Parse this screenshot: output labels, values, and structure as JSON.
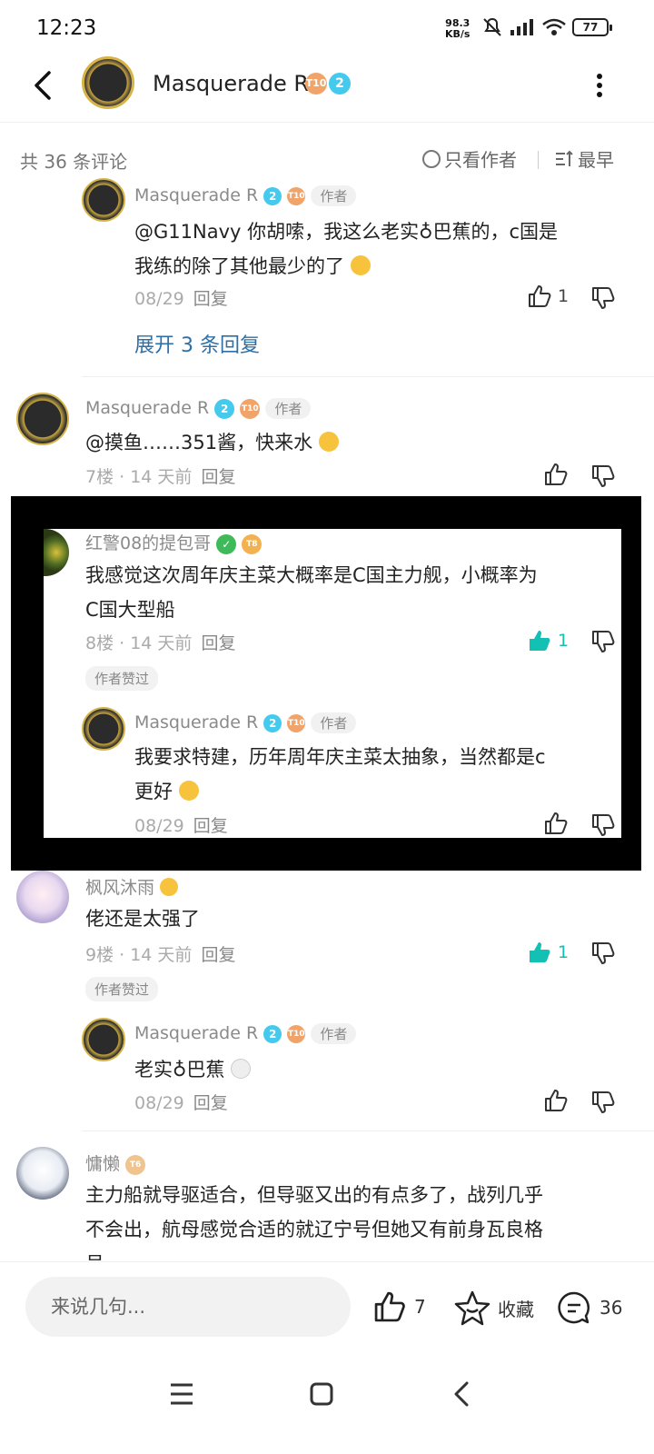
{
  "status": {
    "time": "12:23",
    "net_speed": "98.3",
    "net_unit": "KB/s",
    "battery": "77"
  },
  "header": {
    "name": "Masquerade R",
    "badge_level": "2",
    "badge_t": "T10"
  },
  "filter": {
    "count_label": "共 36 条评论",
    "only_author": "只看作者",
    "sort": "最早"
  },
  "comments": {
    "c0": {
      "name": "Masquerade R",
      "tag": "作者",
      "text_line1": "@G11Navy  你胡嗦，我这么老实♁巴蕉的，c国是",
      "text_line2": "我练的除了其他最少的了",
      "date": "08/29",
      "reply": "回复",
      "likes": "1",
      "expand": "展开 3 条回复"
    },
    "c1": {
      "name": "Masquerade R",
      "tag": "作者",
      "text": "@摸鱼……351酱，快来水",
      "floor": "7楼",
      "time": "14 天前",
      "reply": "回复"
    },
    "c2": {
      "name": "红警08的提包哥",
      "text_line1": "我感觉这次周年庆主菜大概率是C国主力舰，小概率为",
      "text_line2": "C国大型船",
      "floor": "8楼",
      "time": "14 天前",
      "reply": "回复",
      "likes": "1",
      "liked_by_author": "作者赞过",
      "sub": {
        "name": "Masquerade R",
        "tag": "作者",
        "text_line1": "我要求特建，历年周年庆主菜太抽象，当然都是c",
        "text_line2": "更好",
        "date": "08/29",
        "reply": "回复"
      }
    },
    "c3": {
      "name": "枫风沐雨",
      "text": "佬还是太强了",
      "floor": "9楼",
      "time": "14 天前",
      "reply": "回复",
      "likes": "1",
      "liked_by_author": "作者赞过",
      "sub": {
        "name": "Masquerade R",
        "tag": "作者",
        "text": "老实♁巴蕉",
        "date": "08/29",
        "reply": "回复"
      }
    },
    "c4": {
      "name": "慵懒",
      "text_line1": "主力船就导驱适合，但导驱又出的有点多了，战列几乎",
      "text_line2": "不会出，航母感觉合适的就辽宁号但她又有前身瓦良格",
      "text_line3": "号"
    }
  },
  "bottom": {
    "input_placeholder": "来说几句...",
    "likes": "7",
    "favorite": "收藏",
    "comments": "36"
  },
  "colors": {
    "accent_teal": "#12c0b4",
    "link_blue": "#2d6fa6",
    "level_badge": "#45c9ed",
    "t_badge": "#f0a46a"
  }
}
